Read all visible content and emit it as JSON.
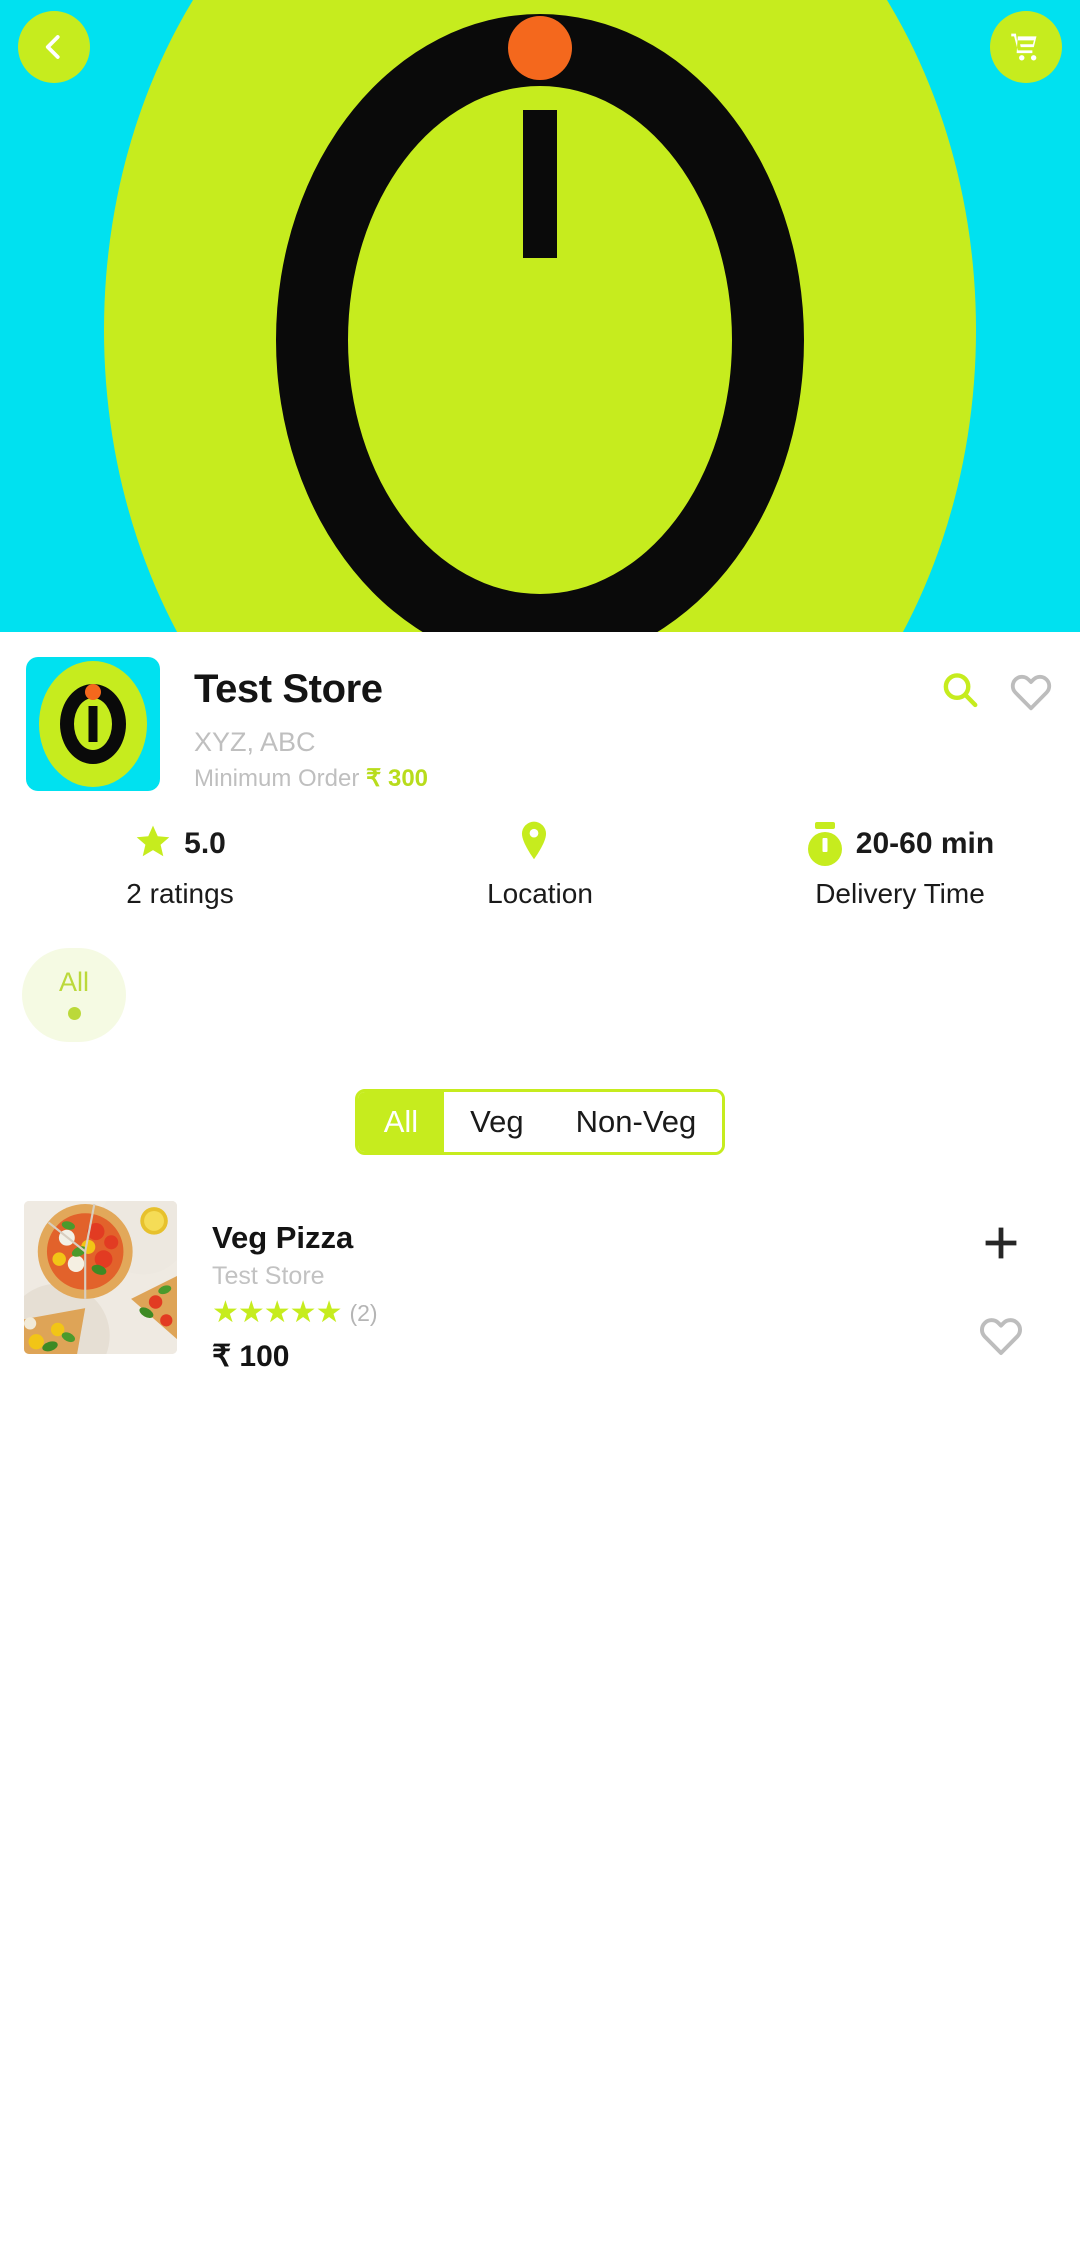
{
  "header": {
    "back_icon": "chevron-left-icon",
    "cart_icon": "shopping-cart-icon"
  },
  "store": {
    "name": "Test Store",
    "address": "XYZ, ABC",
    "minimum_order_label": "Minimum Order",
    "minimum_order_amount": "₹ 300",
    "search_icon": "search-icon",
    "favorite_icon": "heart-outline-icon",
    "accent_color": "#C6EC1E",
    "banner_color": "#00E1F0",
    "stats": [
      {
        "icon": "star-icon",
        "value": "5.0",
        "label": "2 ratings"
      },
      {
        "icon": "location-pin-icon",
        "value": "",
        "label": "Location"
      },
      {
        "icon": "stopwatch-icon",
        "value": "20-60 min",
        "label": "Delivery Time"
      }
    ]
  },
  "categories": [
    {
      "label": "All",
      "selected": true
    }
  ],
  "veg_filter": {
    "options": [
      {
        "label": "All",
        "active": true
      },
      {
        "label": "Veg",
        "active": false
      },
      {
        "label": "Non-Veg",
        "active": false
      }
    ]
  },
  "products": [
    {
      "name": "Veg Pizza",
      "store": "Test Store",
      "stars": "★★★★★",
      "rating_count": "(2)",
      "price": "₹ 100",
      "add_icon": "plus-icon",
      "favorite_icon": "heart-outline-icon",
      "image": "pizza-photo"
    }
  ]
}
